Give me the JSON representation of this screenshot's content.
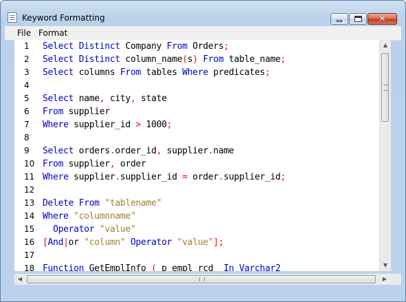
{
  "window": {
    "title": "Keyword Formatting",
    "controls": {
      "minimize": "",
      "maximize": "",
      "close": "✕"
    }
  },
  "menu": {
    "items": [
      "File",
      "Format"
    ]
  },
  "colors": {
    "keyword": "#0000cc",
    "operator": "#ff0000",
    "string": "#a08030",
    "identifier": "#000000"
  },
  "editor": {
    "lines": [
      {
        "num": "1",
        "tokens": [
          [
            "kw",
            "Select"
          ],
          [
            "id",
            " "
          ],
          [
            "kw",
            "Distinct"
          ],
          [
            "id",
            " Company "
          ],
          [
            "kw",
            "From"
          ],
          [
            "id",
            " Orders"
          ],
          [
            "op",
            ";"
          ]
        ]
      },
      {
        "num": "2",
        "tokens": [
          [
            "kw",
            "Select"
          ],
          [
            "id",
            " "
          ],
          [
            "kw",
            "Distinct"
          ],
          [
            "id",
            " column_name"
          ],
          [
            "op",
            "("
          ],
          [
            "id",
            "s"
          ],
          [
            "op",
            ")"
          ],
          [
            "id",
            " "
          ],
          [
            "kw",
            "From"
          ],
          [
            "id",
            " table_name"
          ],
          [
            "op",
            ";"
          ]
        ]
      },
      {
        "num": "3",
        "tokens": [
          [
            "kw",
            "Select"
          ],
          [
            "id",
            " columns "
          ],
          [
            "kw",
            "From"
          ],
          [
            "id",
            " tables "
          ],
          [
            "kw",
            "Where"
          ],
          [
            "id",
            " predicates"
          ],
          [
            "op",
            ";"
          ]
        ]
      },
      {
        "num": "4",
        "tokens": []
      },
      {
        "num": "5",
        "tokens": [
          [
            "kw",
            "Select"
          ],
          [
            "id",
            " name"
          ],
          [
            "op",
            ","
          ],
          [
            "id",
            " city"
          ],
          [
            "op",
            ","
          ],
          [
            "id",
            " state"
          ]
        ]
      },
      {
        "num": "6",
        "tokens": [
          [
            "kw",
            "From"
          ],
          [
            "id",
            " supplier"
          ]
        ]
      },
      {
        "num": "7",
        "tokens": [
          [
            "kw",
            "Where"
          ],
          [
            "id",
            " supplier_id "
          ],
          [
            "op",
            ">"
          ],
          [
            "id",
            " 1000"
          ],
          [
            "op",
            ";"
          ]
        ]
      },
      {
        "num": "8",
        "tokens": []
      },
      {
        "num": "9",
        "tokens": [
          [
            "kw",
            "Select"
          ],
          [
            "id",
            " orders"
          ],
          [
            "op",
            "."
          ],
          [
            "id",
            "order_id"
          ],
          [
            "op",
            ","
          ],
          [
            "id",
            " supplier"
          ],
          [
            "op",
            "."
          ],
          [
            "id",
            "name"
          ]
        ]
      },
      {
        "num": "10",
        "tokens": [
          [
            "kw",
            "From"
          ],
          [
            "id",
            " supplier"
          ],
          [
            "op",
            ","
          ],
          [
            "id",
            " order"
          ]
        ]
      },
      {
        "num": "11",
        "tokens": [
          [
            "kw",
            "Where"
          ],
          [
            "id",
            " supplier"
          ],
          [
            "op",
            "."
          ],
          [
            "id",
            "supplier_id "
          ],
          [
            "op",
            "="
          ],
          [
            "id",
            " order"
          ],
          [
            "op",
            "."
          ],
          [
            "id",
            "supplier_id"
          ],
          [
            "op",
            ";"
          ]
        ]
      },
      {
        "num": "12",
        "tokens": []
      },
      {
        "num": "13",
        "tokens": [
          [
            "kw",
            "Delete"
          ],
          [
            "id",
            " "
          ],
          [
            "kw",
            "From"
          ],
          [
            "id",
            " "
          ],
          [
            "str",
            "\"tablename\""
          ]
        ]
      },
      {
        "num": "14",
        "tokens": [
          [
            "kw",
            "Where"
          ],
          [
            "id",
            " "
          ],
          [
            "str",
            "\"columnname\""
          ]
        ]
      },
      {
        "num": "15",
        "tokens": [
          [
            "id",
            "  "
          ],
          [
            "kw",
            "Operator"
          ],
          [
            "id",
            " "
          ],
          [
            "str",
            "\"value\""
          ]
        ]
      },
      {
        "num": "16",
        "tokens": [
          [
            "op",
            "["
          ],
          [
            "kw",
            "And"
          ],
          [
            "op",
            "|"
          ],
          [
            "id",
            "or "
          ],
          [
            "str",
            "\"column\""
          ],
          [
            "id",
            " "
          ],
          [
            "kw",
            "Operator"
          ],
          [
            "id",
            " "
          ],
          [
            "str",
            "\"value\""
          ],
          [
            "op",
            "];"
          ]
        ]
      },
      {
        "num": "17",
        "tokens": []
      },
      {
        "num": "18",
        "tokens": [
          [
            "kw",
            "Function"
          ],
          [
            "id",
            " GetEmplInfo "
          ],
          [
            "op",
            "("
          ],
          [
            "id",
            " p_empl_rcd  "
          ],
          [
            "kw",
            "In"
          ],
          [
            "id",
            " "
          ],
          [
            "kw",
            "Varchar2"
          ]
        ]
      }
    ]
  },
  "scrollbars": {
    "up_arrow": "▲",
    "down_arrow": "▼",
    "left_arrow": "◀",
    "right_arrow": "▶"
  }
}
